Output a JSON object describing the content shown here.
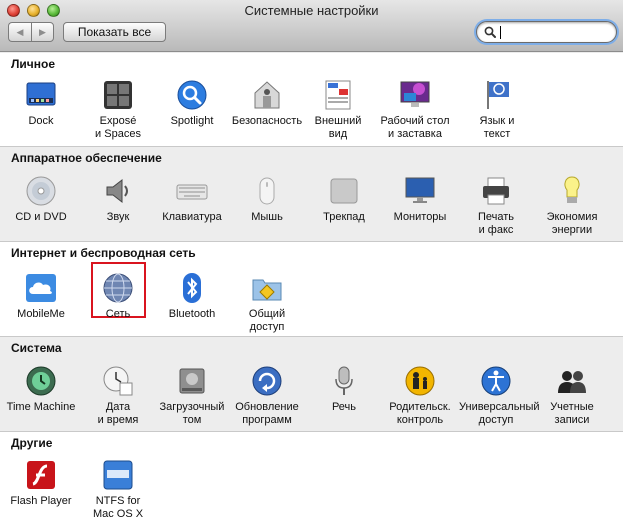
{
  "window": {
    "title": "Системные настройки"
  },
  "toolbar": {
    "back": "◀",
    "forward": "▶",
    "show_all": "Показать все"
  },
  "search": {
    "value": "",
    "placeholder": ""
  },
  "sections": [
    {
      "title": "Личное",
      "items": [
        {
          "label": "Dock",
          "icon": "dock-icon"
        },
        {
          "label": "Exposé\nи Spaces",
          "icon": "expose-icon"
        },
        {
          "label": "Spotlight",
          "icon": "spotlight-icon"
        },
        {
          "label": "Безопасность",
          "icon": "security-icon"
        },
        {
          "label": "Внешний\nвид",
          "icon": "appearance-icon"
        },
        {
          "label": "Рабочий стол\nи заставка",
          "icon": "desktop-icon"
        },
        {
          "label": "Язык и\nтекст",
          "icon": "language-icon"
        }
      ]
    },
    {
      "title": "Аппаратное обеспечение",
      "items": [
        {
          "label": "CD и DVD",
          "icon": "cd-dvd-icon"
        },
        {
          "label": "Звук",
          "icon": "sound-icon"
        },
        {
          "label": "Клавиатура",
          "icon": "keyboard-icon"
        },
        {
          "label": "Мышь",
          "icon": "mouse-icon"
        },
        {
          "label": "Трекпад",
          "icon": "trackpad-icon"
        },
        {
          "label": "Мониторы",
          "icon": "displays-icon"
        },
        {
          "label": "Печать\nи факс",
          "icon": "print-icon"
        },
        {
          "label": "Экономия\nэнергии",
          "icon": "energy-icon"
        }
      ]
    },
    {
      "title": "Интернет и беспроводная сеть",
      "items": [
        {
          "label": "MobileMe",
          "icon": "mobileme-icon"
        },
        {
          "label": "Сеть",
          "icon": "network-icon",
          "highlighted": true
        },
        {
          "label": "Bluetooth",
          "icon": "bluetooth-icon"
        },
        {
          "label": "Общий\nдоступ",
          "icon": "sharing-icon"
        }
      ]
    },
    {
      "title": "Система",
      "items": [
        {
          "label": "Time Machine",
          "icon": "time-machine-icon"
        },
        {
          "label": "Дата\nи время",
          "icon": "date-time-icon"
        },
        {
          "label": "Загрузочный\nтом",
          "icon": "startup-disk-icon"
        },
        {
          "label": "Обновление\nпрограмм",
          "icon": "software-update-icon"
        },
        {
          "label": "Речь",
          "icon": "speech-icon"
        },
        {
          "label": "Родительск.\nконтроль",
          "icon": "parental-controls-icon"
        },
        {
          "label": "Универсальный\nдоступ",
          "icon": "universal-access-icon"
        },
        {
          "label": "Учетные\nзаписи",
          "icon": "accounts-icon"
        }
      ]
    },
    {
      "title": "Другие",
      "items": [
        {
          "label": "Flash Player",
          "icon": "flash-player-icon"
        },
        {
          "label": "NTFS for\nMac OS X",
          "icon": "ntfs-icon"
        }
      ]
    }
  ],
  "colors": {
    "highlight": "#d9141f",
    "search_focus": "#7eaee8"
  }
}
